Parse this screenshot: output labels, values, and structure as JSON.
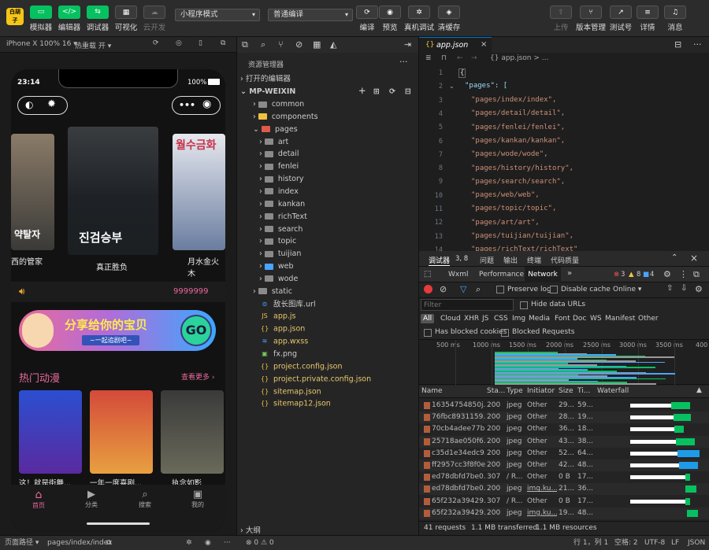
{
  "toolbar": {
    "buttons": [
      {
        "label": "模拟器"
      },
      {
        "label": "编辑器"
      },
      {
        "label": "调试器"
      },
      {
        "label": "可视化"
      },
      {
        "label": "云开发"
      }
    ],
    "mode_select": "小程序模式",
    "compile_select": "普通编译",
    "actions": [
      {
        "label": "编译"
      },
      {
        "label": "预览"
      },
      {
        "label": "真机调试"
      },
      {
        "label": "清缓存"
      }
    ],
    "right": [
      {
        "label": "上传"
      },
      {
        "label": "版本管理"
      },
      {
        "label": "测试号"
      },
      {
        "label": "详情"
      },
      {
        "label": "消息"
      }
    ]
  },
  "simulator": {
    "device": "iPhone X 100% 16 ▾",
    "hot_reload": "热重载 开 ▾",
    "time": "23:14",
    "battery": "100%",
    "carousel": [
      {
        "title": "西的管家"
      },
      {
        "title": "真正胜负"
      },
      {
        "title": "月水金火木"
      }
    ],
    "poster_main_text": "진검승부",
    "poster_right_text": "월수금화",
    "poster_left_text": "약탈자",
    "counter": "9999999",
    "banner_text": "分享给你的宝贝",
    "banner_sub": "~一起追剧吧~",
    "banner_go": "GO",
    "section_title": "热门动漫",
    "section_more": "查看更多",
    "shows": [
      {
        "title": "这！就是街舞..."
      },
      {
        "title": "一年一度喜剧..."
      },
      {
        "title": "执念如影"
      }
    ],
    "tabs": [
      {
        "label": "首页"
      },
      {
        "label": "分类"
      },
      {
        "label": "搜索"
      },
      {
        "label": "我的"
      }
    ]
  },
  "explorer": {
    "title": "资源管理器",
    "open_editors": "打开的编辑器",
    "project": "MP-WEIXIN",
    "items": [
      {
        "name": "common"
      },
      {
        "name": "components"
      },
      {
        "name": "pages"
      },
      {
        "name": "art"
      },
      {
        "name": "detail"
      },
      {
        "name": "fenlei"
      },
      {
        "name": "history"
      },
      {
        "name": "index"
      },
      {
        "name": "kankan"
      },
      {
        "name": "richText"
      },
      {
        "name": "search"
      },
      {
        "name": "topic"
      },
      {
        "name": "tuijian"
      },
      {
        "name": "web"
      },
      {
        "name": "wode"
      },
      {
        "name": "static"
      },
      {
        "name": "敌长图库.url"
      },
      {
        "name": "app.js"
      },
      {
        "name": "app.json"
      },
      {
        "name": "app.wxss"
      },
      {
        "name": "fx.png"
      },
      {
        "name": "project.config.json"
      },
      {
        "name": "project.private.config.json"
      },
      {
        "name": "sitemap.json"
      },
      {
        "name": "sitemap12.json"
      }
    ],
    "outline": "大纲",
    "problems": "⊗ 0 ⚠ 0"
  },
  "editor": {
    "tab": "app.json",
    "breadcrumb": "{} app.json > ...",
    "line_numbers": [
      "1",
      "2",
      "3",
      "4",
      "5",
      "6",
      "7",
      "8",
      "9",
      "10",
      "11",
      "12",
      "13",
      "14"
    ],
    "open_brace": "{",
    "pages_key": "\"pages\": [",
    "lines": [
      "\"pages/index/index\",",
      "\"pages/detail/detail\",",
      "\"pages/fenlei/fenlei\",",
      "\"pages/kankan/kankan\",",
      "\"pages/wode/wode\",",
      "\"pages/history/history\",",
      "\"pages/search/search\",",
      "\"pages/web/web\",",
      "\"pages/topic/topic\",",
      "\"pages/art/art\",",
      "\"pages/tuijian/tuijian\",",
      "\"pages/richText/richText\""
    ]
  },
  "devtools": {
    "tabs": [
      {
        "label": "调试器"
      },
      {
        "label": "3, 8"
      },
      {
        "label": "问题"
      },
      {
        "label": "输出"
      },
      {
        "label": "终端"
      },
      {
        "label": "代码质量"
      }
    ],
    "panels": [
      {
        "label": "Wxml"
      },
      {
        "label": "Performance"
      },
      {
        "label": "Network"
      }
    ],
    "errors": "3",
    "warnings": "8",
    "info": "4",
    "preserve_log": "Preserve log",
    "disable_cache": "Disable cache",
    "throttle": "Online",
    "filter_placeholder": "Filter",
    "hide_data_urls": "Hide data URLs",
    "types": [
      "All",
      "Cloud",
      "XHR",
      "JS",
      "CSS",
      "Img",
      "Media",
      "Font",
      "Doc",
      "WS",
      "Manifest",
      "Other"
    ],
    "blocked_cookies": "Has blocked cookies",
    "blocked_requests": "Blocked Requests",
    "timeline_ticks": [
      "500 ms",
      "1000 ms",
      "1500 ms",
      "2000 ms",
      "2500 ms",
      "3000 ms",
      "3500 ms",
      "400"
    ],
    "columns": [
      "Name",
      "Sta...",
      "Type",
      "Initiator",
      "Size",
      "Ti...",
      "Waterfall"
    ],
    "rows": [
      {
        "name": "16354754850j...",
        "status": "200",
        "type": "jpeg",
        "init": "Other",
        "size": "29...",
        "time": "59..."
      },
      {
        "name": "76fbc8931159...",
        "status": "200",
        "type": "jpeg",
        "init": "Other",
        "size": "28...",
        "time": "19..."
      },
      {
        "name": "70cb4adee77b...",
        "status": "200",
        "type": "jpeg",
        "init": "Other",
        "size": "36...",
        "time": "18..."
      },
      {
        "name": "25718ae050f6...",
        "status": "200",
        "type": "jpeg",
        "init": "Other",
        "size": "43...",
        "time": "38..."
      },
      {
        "name": "c35d1e34edc9...",
        "status": "200",
        "type": "jpeg",
        "init": "Other",
        "size": "52...",
        "time": "64..."
      },
      {
        "name": "ff2957cc3f8f0e...",
        "status": "200",
        "type": "jpeg",
        "init": "Other",
        "size": "42...",
        "time": "48..."
      },
      {
        "name": "ed78dbfd7be0...",
        "status": "307",
        "type": "/ R...",
        "init": "Other",
        "size": "0 B",
        "time": "17..."
      },
      {
        "name": "ed78dbfd7be0...",
        "status": "200",
        "type": "jpeg",
        "init": "img.ku...",
        "size": "21...",
        "time": "36..."
      },
      {
        "name": "65f232a39429...",
        "status": "307",
        "type": "/ R...",
        "init": "Other",
        "size": "0 B",
        "time": "17..."
      },
      {
        "name": "65f232a39429...",
        "status": "200",
        "type": "jpeg",
        "init": "img.ku...",
        "size": "19...",
        "time": "48..."
      }
    ],
    "summary": [
      "41 requests",
      "1.1 MB transferred",
      "1.1 MB resources"
    ]
  },
  "status": {
    "path_label": "页面路径 ▾",
    "path": "pages/index/index",
    "position": "行 1，列 1",
    "spaces": "空格: 2",
    "encoding": "UTF-8",
    "eol": "LF",
    "lang": "JSON"
  },
  "colors": {
    "accent": "#07c160",
    "pink": "#e86b9b",
    "blue": "#1a73e8"
  }
}
